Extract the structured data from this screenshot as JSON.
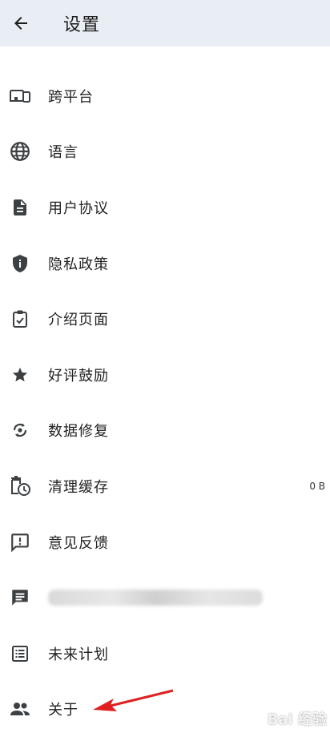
{
  "header": {
    "title": "设置"
  },
  "items": [
    {
      "label": "跨平台",
      "icon": "devices-icon"
    },
    {
      "label": "语言",
      "icon": "globe-icon"
    },
    {
      "label": "用户协议",
      "icon": "document-icon"
    },
    {
      "label": "隐私政策",
      "icon": "shield-icon"
    },
    {
      "label": "介绍页面",
      "icon": "clipboard-check-icon"
    },
    {
      "label": "好评鼓励",
      "icon": "star-icon"
    },
    {
      "label": "数据修复",
      "icon": "repair-icon"
    },
    {
      "label": "清理缓存",
      "icon": "delete-clock-icon",
      "value": "0 B"
    },
    {
      "label": "意见反馈",
      "icon": "feedback-icon"
    },
    {
      "label": "",
      "icon": "message-icon"
    },
    {
      "label": "未来计划",
      "icon": "list-icon"
    },
    {
      "label": "关于",
      "icon": "people-icon"
    }
  ],
  "watermark": "Bai 经验",
  "colors": {
    "header_bg": "#e9eef5",
    "icon": "#3c4043",
    "arrow": "#e02020"
  }
}
